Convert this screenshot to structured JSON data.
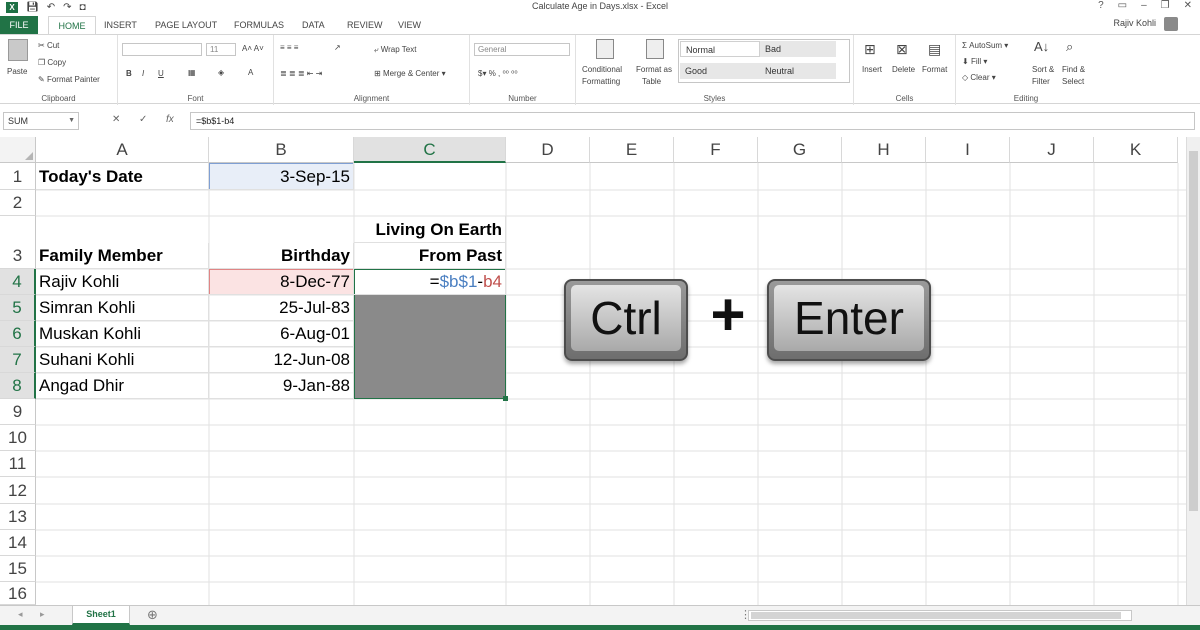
{
  "app": {
    "title": "Calculate Age in Days.xlsx - Excel",
    "user": "Rajiv Kohli",
    "window_controls": [
      "?",
      "▭",
      "–",
      "❐",
      "✕"
    ]
  },
  "tabs": [
    "FILE",
    "HOME",
    "INSERT",
    "PAGE LAYOUT",
    "FORMULAS",
    "DATA",
    "REVIEW",
    "VIEW"
  ],
  "ribbon": {
    "clipboard": {
      "paste": "Paste",
      "cut": "Cut",
      "copy": "Copy",
      "format_painter": "Format Painter",
      "label": "Clipboard"
    },
    "font": {
      "size": "11",
      "label": "Font"
    },
    "alignment": {
      "wrap": "Wrap Text",
      "merge": "Merge & Center",
      "label": "Alignment"
    },
    "number": {
      "format": "General",
      "label": "Number"
    },
    "styles": {
      "cond": "Conditional",
      "cond2": "Formatting",
      "fmt_table": "Format as",
      "fmt_table2": "Table",
      "normal": "Normal",
      "bad": "Bad",
      "good": "Good",
      "neutral": "Neutral",
      "label": "Styles"
    },
    "cells": {
      "insert": "Insert",
      "delete": "Delete",
      "format": "Format",
      "label": "Cells"
    },
    "editing": {
      "autosum": "AutoSum",
      "fill": "Fill",
      "clear": "Clear",
      "sort": "Sort &",
      "sort2": "Filter",
      "find": "Find &",
      "find2": "Select",
      "label": "Editing"
    }
  },
  "formula_bar": {
    "name_box": "SUM",
    "formula": "=$b$1-b4"
  },
  "columns": [
    "A",
    "B",
    "C",
    "D",
    "E",
    "F",
    "G",
    "H",
    "I",
    "J",
    "K"
  ],
  "rows": [
    "1",
    "2",
    "3",
    "4",
    "5",
    "6",
    "7",
    "8",
    "9",
    "10",
    "11",
    "12",
    "13",
    "14",
    "15",
    "16"
  ],
  "cells": {
    "A1": "Today's Date",
    "B1": "3-Sep-15",
    "C3a": "Living On Earth",
    "C3b": "From Past",
    "A3": "Family Member",
    "B3": "Birthday",
    "A4": "Rajiv Kohli",
    "B4": "8-Dec-77",
    "C4_eq": "=",
    "C4_ref1": "$b$1",
    "C4_minus": "-",
    "C4_ref2": "b4",
    "A5": "Simran Kohli",
    "B5": "25-Jul-83",
    "A6": "Muskan Kohli",
    "B6": "6-Aug-01",
    "A7": "Suhani Kohli",
    "B7": "12-Jun-08",
    "A8": "Angad Dhir",
    "B8": "9-Jan-88"
  },
  "overlay": {
    "key1": "Ctrl",
    "plus": "+",
    "key2": "Enter"
  },
  "sheet": {
    "tab": "Sheet1",
    "add": "⊕"
  },
  "colors": {
    "excel_green": "#217346",
    "ref1": "#4a7fc1",
    "ref2": "#c0504d",
    "selection": "#8a8a8a"
  }
}
